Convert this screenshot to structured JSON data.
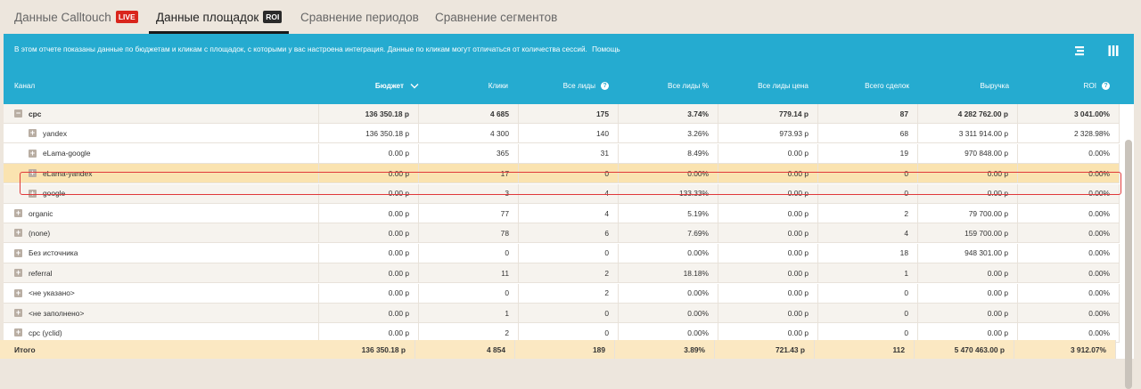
{
  "tabs": [
    {
      "label": "Данные Calltouch",
      "badge": "LIVE"
    },
    {
      "label": "Данные площадок",
      "badge": "ROI"
    },
    {
      "label": "Сравнение периодов",
      "badge": ""
    },
    {
      "label": "Сравнение сегментов",
      "badge": ""
    }
  ],
  "info": {
    "text": "В этом отчете показаны данные по бюджетам и кликам с площадок, с которыми у вас настроена интеграция. Данные по кликам могут отличаться от количества сессий.",
    "help": "Помощь"
  },
  "columns": [
    "Канал",
    "Бюджет",
    "Клики",
    "Все лиды",
    "Все лиды %",
    "Все лиды цена",
    "Всего сделок",
    "Выручка",
    "ROI"
  ],
  "rows": [
    {
      "name": "cpc",
      "budget": "136 350.18 р",
      "clicks": "4 685",
      "leads": "175",
      "leads_pct": "3.74%",
      "lead_price": "779.14 р",
      "deals": "87",
      "revenue": "4 282 762.00 р",
      "roi": "3 041.00%"
    },
    {
      "name": "yandex",
      "budget": "136 350.18 р",
      "clicks": "4 300",
      "leads": "140",
      "leads_pct": "3.26%",
      "lead_price": "973.93 р",
      "deals": "68",
      "revenue": "3 311 914.00 р",
      "roi": "2 328.98%"
    },
    {
      "name": "eLama-google",
      "budget": "0.00 р",
      "clicks": "365",
      "leads": "31",
      "leads_pct": "8.49%",
      "lead_price": "0.00 р",
      "deals": "19",
      "revenue": "970 848.00 р",
      "roi": "0.00%"
    },
    {
      "name": "eLama-yandex",
      "budget": "0.00 р",
      "clicks": "17",
      "leads": "0",
      "leads_pct": "0.00%",
      "lead_price": "0.00 р",
      "deals": "0",
      "revenue": "0.00 р",
      "roi": "0.00%"
    },
    {
      "name": "google",
      "budget": "0.00 р",
      "clicks": "3",
      "leads": "4",
      "leads_pct": "133.33%",
      "lead_price": "0.00 р",
      "deals": "0",
      "revenue": "0.00 р",
      "roi": "0.00%"
    },
    {
      "name": "organic",
      "budget": "0.00 р",
      "clicks": "77",
      "leads": "4",
      "leads_pct": "5.19%",
      "lead_price": "0.00 р",
      "deals": "2",
      "revenue": "79 700.00 р",
      "roi": "0.00%"
    },
    {
      "name": "(none)",
      "budget": "0.00 р",
      "clicks": "78",
      "leads": "6",
      "leads_pct": "7.69%",
      "lead_price": "0.00 р",
      "deals": "4",
      "revenue": "159 700.00 р",
      "roi": "0.00%"
    },
    {
      "name": "Без источника",
      "budget": "0.00 р",
      "clicks": "0",
      "leads": "0",
      "leads_pct": "0.00%",
      "lead_price": "0.00 р",
      "deals": "18",
      "revenue": "948 301.00 р",
      "roi": "0.00%"
    },
    {
      "name": "referral",
      "budget": "0.00 р",
      "clicks": "11",
      "leads": "2",
      "leads_pct": "18.18%",
      "lead_price": "0.00 р",
      "deals": "1",
      "revenue": "0.00 р",
      "roi": "0.00%"
    },
    {
      "name": "<не указано>",
      "budget": "0.00 р",
      "clicks": "0",
      "leads": "2",
      "leads_pct": "0.00%",
      "lead_price": "0.00 р",
      "deals": "0",
      "revenue": "0.00 р",
      "roi": "0.00%"
    },
    {
      "name": "<не заполнено>",
      "budget": "0.00 р",
      "clicks": "1",
      "leads": "0",
      "leads_pct": "0.00%",
      "lead_price": "0.00 р",
      "deals": "0",
      "revenue": "0.00 р",
      "roi": "0.00%"
    },
    {
      "name": "cpc (yclid)",
      "budget": "0.00 р",
      "clicks": "2",
      "leads": "0",
      "leads_pct": "0.00%",
      "lead_price": "0.00 р",
      "deals": "0",
      "revenue": "0.00 р",
      "roi": "0.00%"
    }
  ],
  "total": {
    "name": "Итого",
    "budget": "136 350.18 р",
    "clicks": "4 854",
    "leads": "189",
    "leads_pct": "3.89%",
    "lead_price": "721.43 р",
    "deals": "112",
    "revenue": "5 470 463.00 р",
    "roi": "3 912.07%"
  }
}
